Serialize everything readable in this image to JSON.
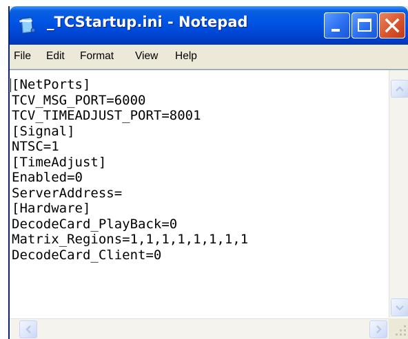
{
  "window": {
    "title": "_TCStartup.ini - Notepad",
    "icon": "notepad-icon"
  },
  "titlebar_buttons": {
    "minimize_icon": "minimize-icon",
    "maximize_icon": "maximize-icon",
    "close_icon": "close-icon"
  },
  "menu": {
    "items": [
      "File",
      "Edit",
      "Format",
      "View",
      "Help"
    ]
  },
  "editor": {
    "lines": [
      "[NetPorts]",
      "TCV_MSG_PORT=6000",
      "TCV_TIMEADJUST_PORT=8001",
      "[Signal]",
      "NTSC=1",
      "[TimeAdjust]",
      "Enabled=0",
      "ServerAddress=",
      "[Hardware]",
      "DecodeCard_PlayBack=0",
      "Matrix_Regions=1,1,1,1,1,1,1,1",
      "DecodeCard_Client=0"
    ]
  },
  "colors": {
    "titlebar": "#0055e5",
    "close_button": "#d9542c",
    "menubar": "#ece9d8",
    "editor_background": "#ffffff"
  }
}
